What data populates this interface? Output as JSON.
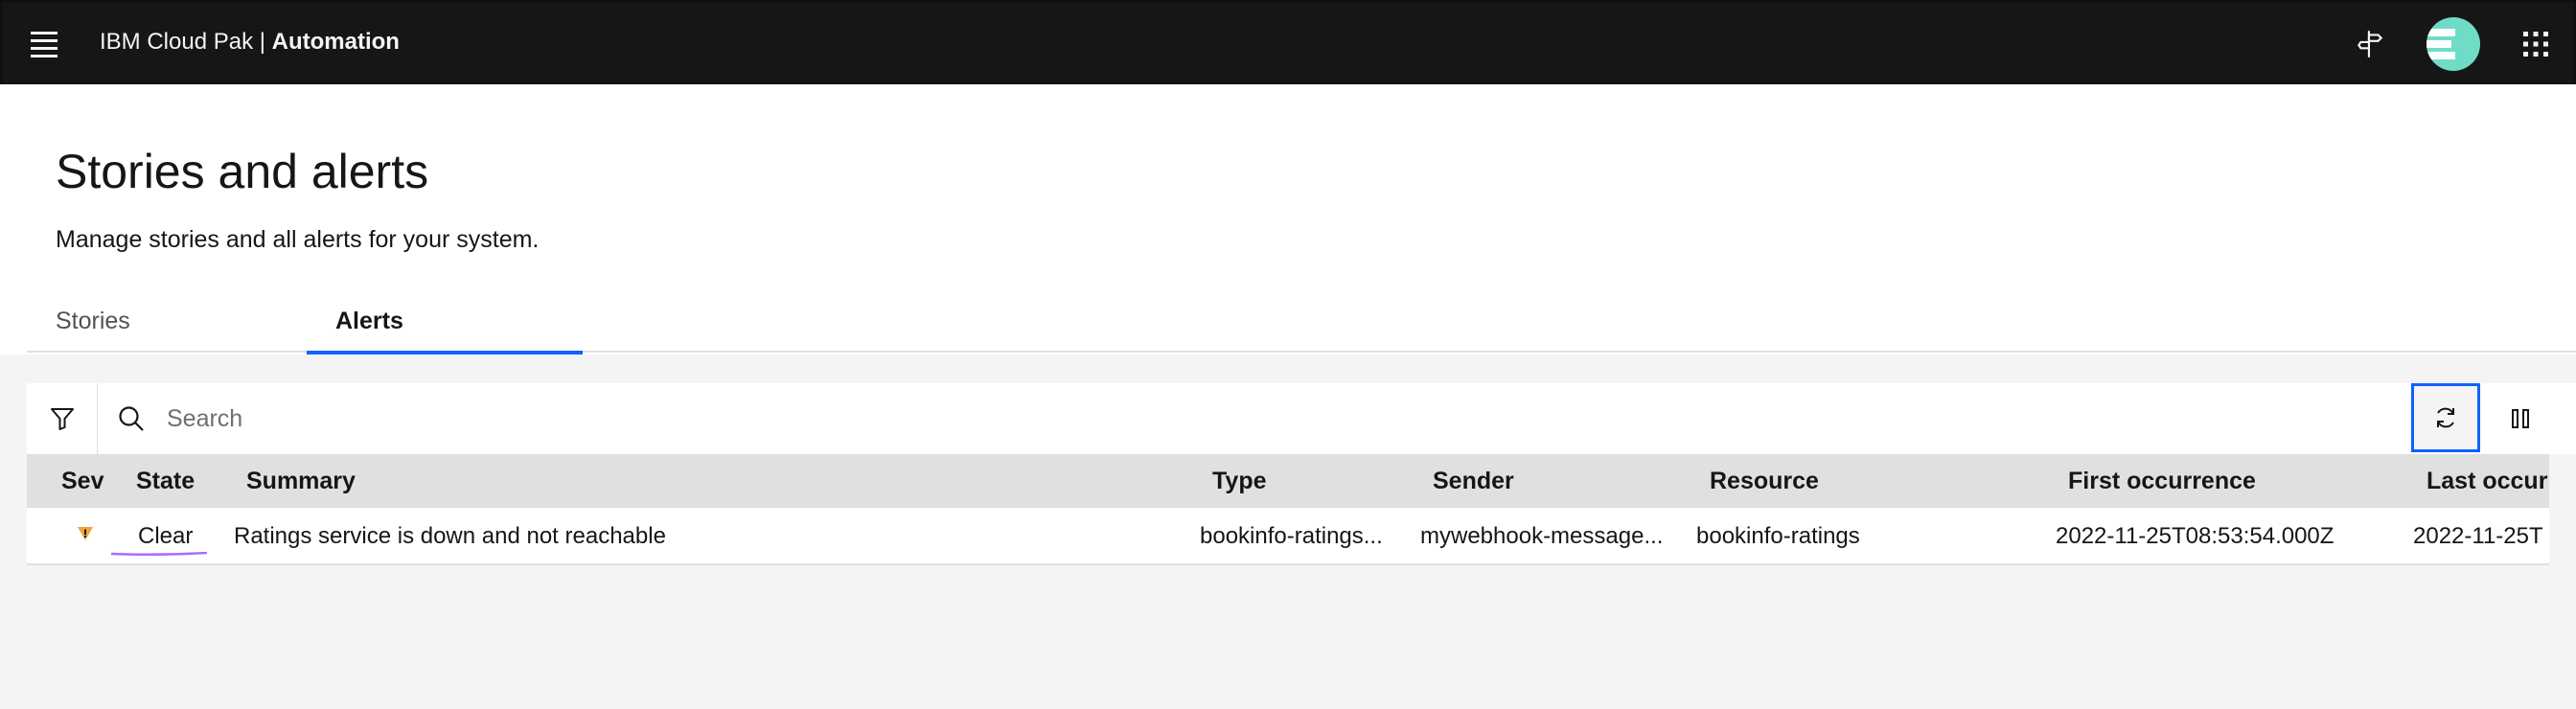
{
  "header": {
    "brand_prefix": "IBM Cloud Pak | ",
    "brand_product": "Automation",
    "icons": [
      "menu-icon",
      "guide-icon",
      "avatar",
      "app-switcher-icon"
    ],
    "colors": {
      "background": "#161616",
      "avatar": "#6fdcc6"
    }
  },
  "page": {
    "title": "Stories and alerts",
    "description": "Manage stories and all alerts for your system."
  },
  "tabs": [
    {
      "label": "Stories",
      "selected": false
    },
    {
      "label": "Alerts",
      "selected": true
    }
  ],
  "toolbar": {
    "search_placeholder": "Search",
    "icons": [
      "filter-icon",
      "search-icon",
      "refresh-icon",
      "pause-icon"
    ],
    "accent": "#0f62fe"
  },
  "table": {
    "columns": [
      "Sev",
      "State",
      "Summary",
      "Type",
      "Sender",
      "Resource",
      "First occurrence",
      "Last occurr"
    ],
    "rows": [
      {
        "severity": "warning",
        "severity_color": "#f1a33c",
        "state": "Clear",
        "state_color": "#a56eff",
        "summary": "Ratings service is down and not reachable",
        "type": "bookinfo-ratings...",
        "sender": "mywebhook-message...",
        "resource": "bookinfo-ratings",
        "first_occurrence": "2022-11-25T08:53:54.000Z",
        "last_occurrence": "2022-11-25T"
      }
    ]
  }
}
